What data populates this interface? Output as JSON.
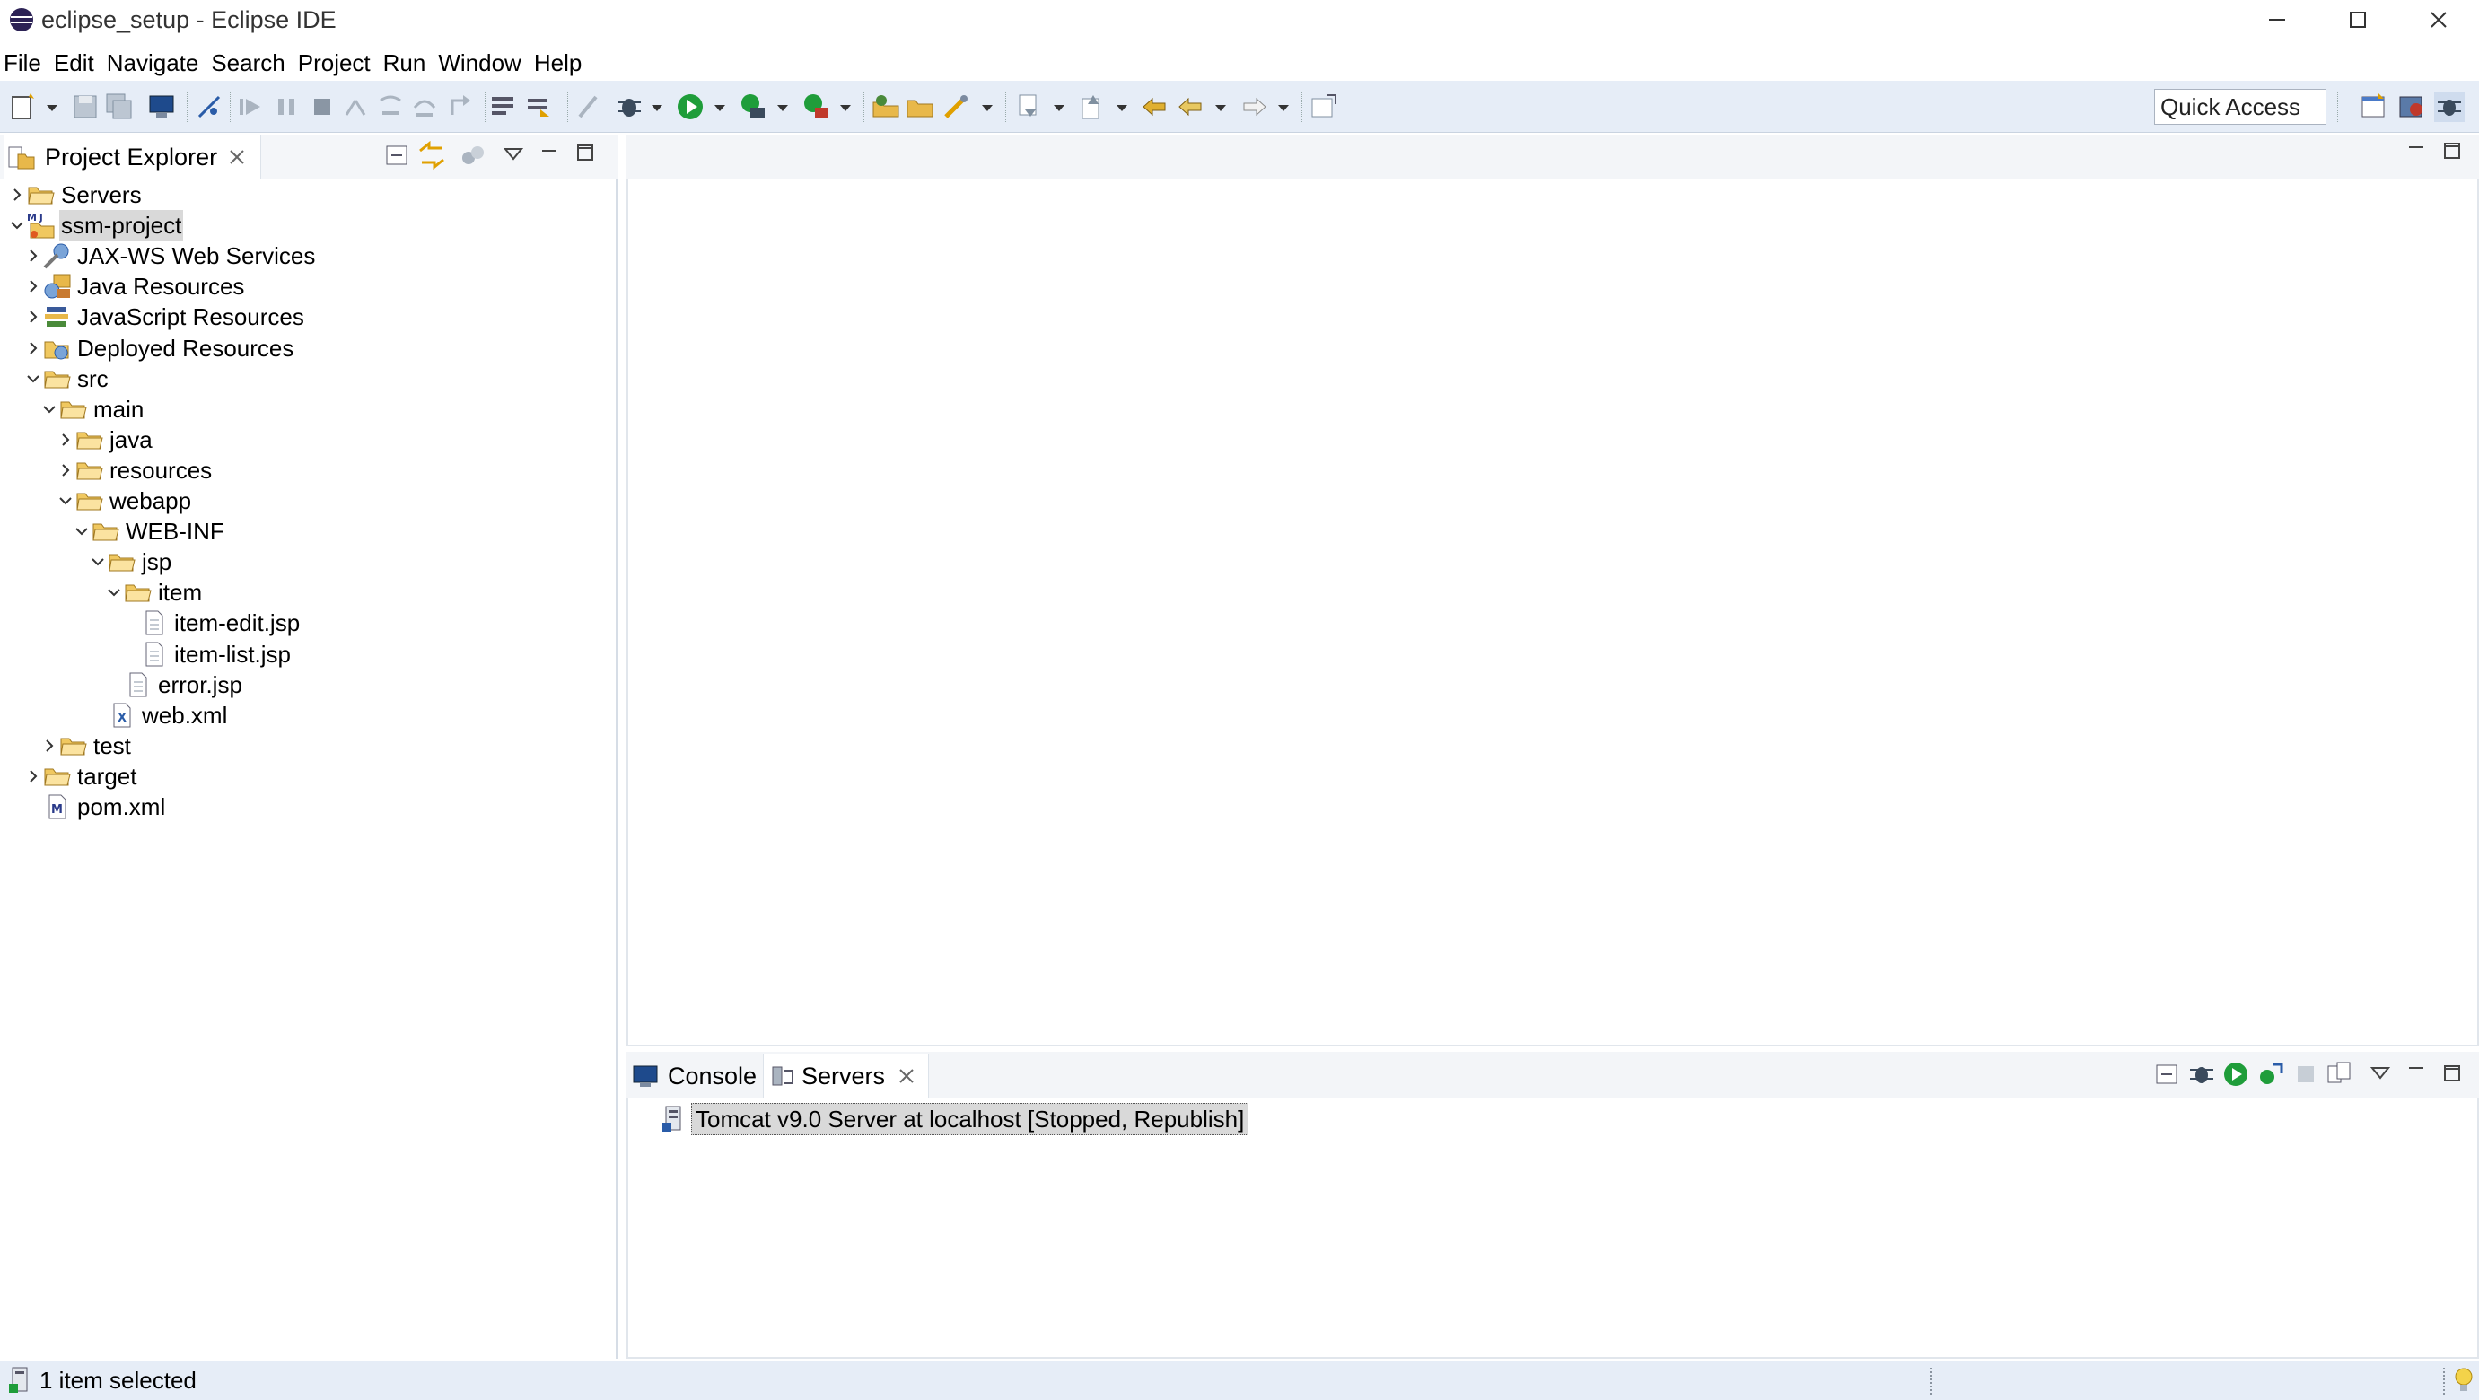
{
  "window": {
    "title": "eclipse_setup - Eclipse IDE",
    "controls": [
      "minimize",
      "maximize",
      "close"
    ]
  },
  "menu": [
    "File",
    "Edit",
    "Navigate",
    "Search",
    "Project",
    "Run",
    "Window",
    "Help"
  ],
  "toolbar": {
    "quick_access": "Quick Access"
  },
  "project_explorer": {
    "title": "Project Explorer",
    "tree": [
      {
        "label": "Servers",
        "level": 0,
        "toggle": "collapsed",
        "icon": "folder-open-icon"
      },
      {
        "label": "ssm-project",
        "level": 0,
        "toggle": "expanded",
        "icon": "maven-project-icon",
        "selected": true
      },
      {
        "label": "JAX-WS Web Services",
        "level": 1,
        "toggle": "collapsed",
        "icon": "webservice-icon"
      },
      {
        "label": "Java Resources",
        "level": 1,
        "toggle": "collapsed",
        "icon": "java-resources-icon"
      },
      {
        "label": "JavaScript Resources",
        "level": 1,
        "toggle": "collapsed",
        "icon": "javascript-resources-icon"
      },
      {
        "label": "Deployed Resources",
        "level": 1,
        "toggle": "collapsed",
        "icon": "deployed-resources-icon"
      },
      {
        "label": "src",
        "level": 1,
        "toggle": "expanded",
        "icon": "folder-open-icon"
      },
      {
        "label": "main",
        "level": 2,
        "toggle": "expanded",
        "icon": "folder-open-icon"
      },
      {
        "label": "java",
        "level": 3,
        "toggle": "collapsed",
        "icon": "folder-open-icon"
      },
      {
        "label": "resources",
        "level": 3,
        "toggle": "collapsed",
        "icon": "folder-open-icon"
      },
      {
        "label": "webapp",
        "level": 3,
        "toggle": "expanded",
        "icon": "folder-open-icon"
      },
      {
        "label": "WEB-INF",
        "level": 4,
        "toggle": "expanded",
        "icon": "folder-open-icon"
      },
      {
        "label": "jsp",
        "level": 5,
        "toggle": "expanded",
        "icon": "folder-open-icon"
      },
      {
        "label": "item",
        "level": 6,
        "toggle": "expanded",
        "icon": "folder-open-icon"
      },
      {
        "label": "item-edit.jsp",
        "level": 7,
        "toggle": "none",
        "icon": "file-icon"
      },
      {
        "label": "item-list.jsp",
        "level": 7,
        "toggle": "none",
        "icon": "file-icon"
      },
      {
        "label": "error.jsp",
        "level": 6,
        "toggle": "none",
        "icon": "file-icon"
      },
      {
        "label": "web.xml",
        "level": 5,
        "toggle": "none",
        "icon": "xml-file-icon"
      },
      {
        "label": "test",
        "level": 2,
        "toggle": "collapsed",
        "icon": "folder-open-icon"
      },
      {
        "label": "target",
        "level": 1,
        "toggle": "collapsed",
        "icon": "folder-open-icon"
      },
      {
        "label": "pom.xml",
        "level": 1,
        "toggle": "none",
        "icon": "maven-pom-icon"
      }
    ]
  },
  "bottom_panel": {
    "tabs": [
      {
        "label": "Console",
        "active": false
      },
      {
        "label": "Servers",
        "active": true
      }
    ],
    "server_entry": "Tomcat v9.0 Server at localhost  [Stopped, Republish]"
  },
  "status": {
    "text": "1 item selected"
  },
  "colors": {
    "toolbar_bg": "#e6edf7",
    "selection_bg": "#d9d9d9",
    "run_green": "#1f9d3a"
  }
}
